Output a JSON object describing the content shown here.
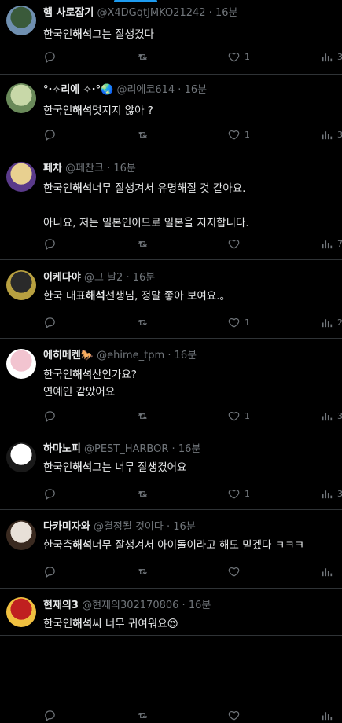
{
  "tweets": [
    {
      "name": "햄 사로잡기",
      "handle": "@X4DGqtJMKO21242",
      "time": "16분",
      "text_pre": "한국인",
      "text_bold": "해석",
      "text_post": "그는 잘생겼다",
      "likes": "1",
      "views": "3",
      "avatar_colors": [
        "#3a5a3a",
        "#6f8fb0"
      ]
    },
    {
      "name": "°·✧리에 ✧·°🌏",
      "handle": "@리에코614",
      "time": "16분",
      "text_pre": "한국인",
      "text_bold": "해석",
      "text_post": "멋지지 않아 ?",
      "likes": "1",
      "views": "3",
      "avatar_colors": [
        "#c8d8a8",
        "#6a8a5a"
      ]
    },
    {
      "name": "페차",
      "handle": "@페찬크",
      "time": "16분",
      "text_pre": "한국인",
      "text_bold": "해석",
      "text_post": "너무 잘생겨서 유명해질 것 같아요.\n\n아니요, 저는 일본인이므로 일본을 지지합니다.",
      "likes": "",
      "views": "7",
      "avatar_colors": [
        "#e8d090",
        "#5a3a8a"
      ]
    },
    {
      "name": "이케다야",
      "handle": "@그 날2",
      "time": "16분",
      "text_pre": "한국 대표",
      "text_bold": "해석",
      "text_post": "선생님, 정말 좋아 보여요.。",
      "likes": "1",
      "views": "2",
      "avatar_colors": [
        "#2a2a2a",
        "#b8a040"
      ]
    },
    {
      "name": "에히메켄🐎",
      "handle": "@ehime_tpm",
      "time": "16분",
      "text_pre": "한국인",
      "text_bold": "해석",
      "text_post": "산인가요?\n연예인 같았어요",
      "likes": "1",
      "views": "3",
      "avatar_colors": [
        "#f2c4d0",
        "#ffffff"
      ]
    },
    {
      "name": "하마노피",
      "handle": "@PEST_HARBOR",
      "time": "16분",
      "text_pre": "한국인",
      "text_bold": "해석",
      "text_post": "그는 너무 잘생겼어요",
      "likes": "1",
      "views": "3",
      "avatar_colors": [
        "#ffffff",
        "#1a1a1a"
      ]
    },
    {
      "name": "다카미자와",
      "handle": "@결정될 것이다",
      "time": "16분",
      "text_pre": "한국측",
      "text_bold": "해석",
      "text_post": "너무 잘생겨서 아이돌이라고 해도 믿겠다 ㅋㅋㅋ",
      "likes": "",
      "views": "",
      "avatar_colors": [
        "#e8e0d8",
        "#3a2a20"
      ]
    },
    {
      "name": "현재의3",
      "handle": "@현재의302170806",
      "time": "16분",
      "text_pre": "한국인",
      "text_bold": "해석",
      "text_post": "씨 너무 귀여워요😍",
      "likes": "",
      "views": "",
      "avatar_colors": [
        "#c02020",
        "#f0c040"
      ]
    }
  ]
}
